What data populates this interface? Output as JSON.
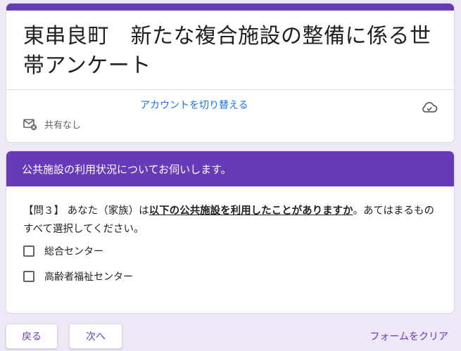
{
  "header": {
    "title": "東串良町　新たな複合施設の整備に係る世帯アンケート",
    "switch_account": "アカウントを切り替える",
    "share_status": "共有なし",
    "icons": {
      "cloud": "cloud-sync-icon",
      "mail": "mail-not-shared-icon"
    }
  },
  "section": {
    "title": "公共施設の利用状況についてお伺いします。",
    "question": {
      "prefix": "【問３】 あなた（家族）は",
      "emphasis": "以下の公共施設を利用したことがありますか",
      "suffix": "。あてはまるものすべて選択してください。"
    },
    "options": [
      {
        "label": "総合センター",
        "checked": false
      },
      {
        "label": "高齢者福祉センター",
        "checked": false
      }
    ]
  },
  "footer": {
    "back_label": "戻る",
    "next_label": "次へ",
    "clear_label": "フォームをクリア"
  },
  "colors": {
    "accent": "#673ab7",
    "background": "#ede7f6",
    "link": "#1a73e8"
  }
}
